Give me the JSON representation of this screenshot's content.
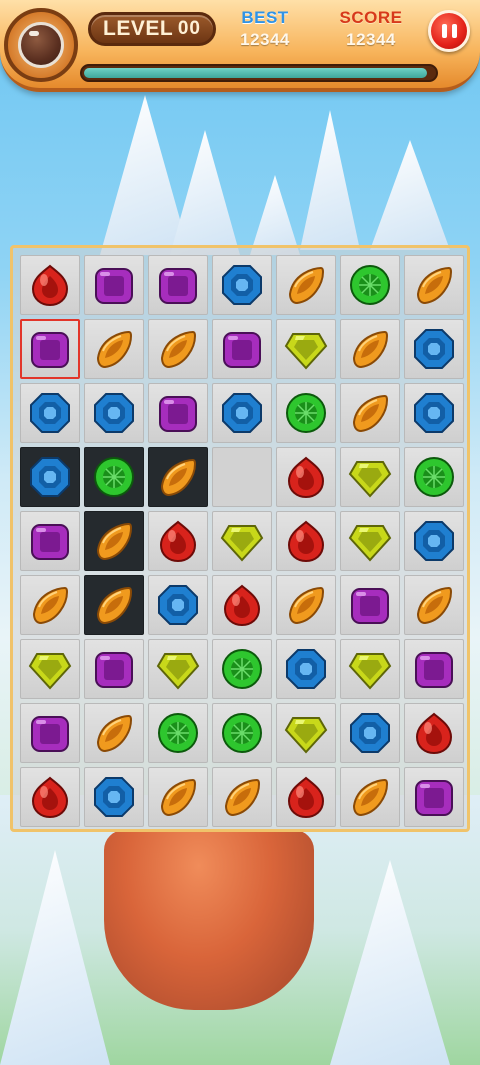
{
  "hud": {
    "level_label": "LEVEL",
    "level_value": "00",
    "best_label": "BEST",
    "best_value": "12344",
    "score_label": "SCORE",
    "score_value": "12344",
    "progress": 0.98
  },
  "icons": {
    "avatar": "avatar-icon",
    "pause": "pause-icon"
  },
  "colors": {
    "red": "#d8231c",
    "purple": "#a62dbd",
    "blue": "#1f7fd0",
    "orange": "#f09a1e",
    "green": "#2ec62e",
    "yellow": "#c8d81a"
  },
  "board": {
    "rows": 9,
    "cols": 7,
    "selected": [
      1,
      0
    ],
    "dark_cells": [
      [
        3,
        0
      ],
      [
        3,
        1
      ],
      [
        3,
        2
      ],
      [
        4,
        1
      ],
      [
        5,
        1
      ]
    ],
    "empty_cells": [
      [
        3,
        3
      ]
    ],
    "gems": [
      [
        "red",
        "purple",
        "purple",
        "blue",
        "orange",
        "green",
        "orange"
      ],
      [
        "purple",
        "orange",
        "orange",
        "purple",
        "yellow",
        "orange",
        "blue"
      ],
      [
        "blue",
        "blue",
        "purple",
        "blue",
        "green",
        "orange",
        "blue"
      ],
      [
        "blue",
        "green",
        "orange",
        "",
        "red",
        "yellow",
        "green"
      ],
      [
        "purple",
        "orange",
        "red",
        "yellow",
        "red",
        "yellow",
        "blue"
      ],
      [
        "orange",
        "orange",
        "blue",
        "red",
        "orange",
        "purple",
        "orange"
      ],
      [
        "yellow",
        "purple",
        "yellow",
        "green",
        "blue",
        "yellow",
        "purple"
      ],
      [
        "purple",
        "orange",
        "green",
        "green",
        "yellow",
        "blue",
        "red"
      ],
      [
        "red",
        "blue",
        "orange",
        "orange",
        "red",
        "orange",
        "purple"
      ]
    ]
  }
}
